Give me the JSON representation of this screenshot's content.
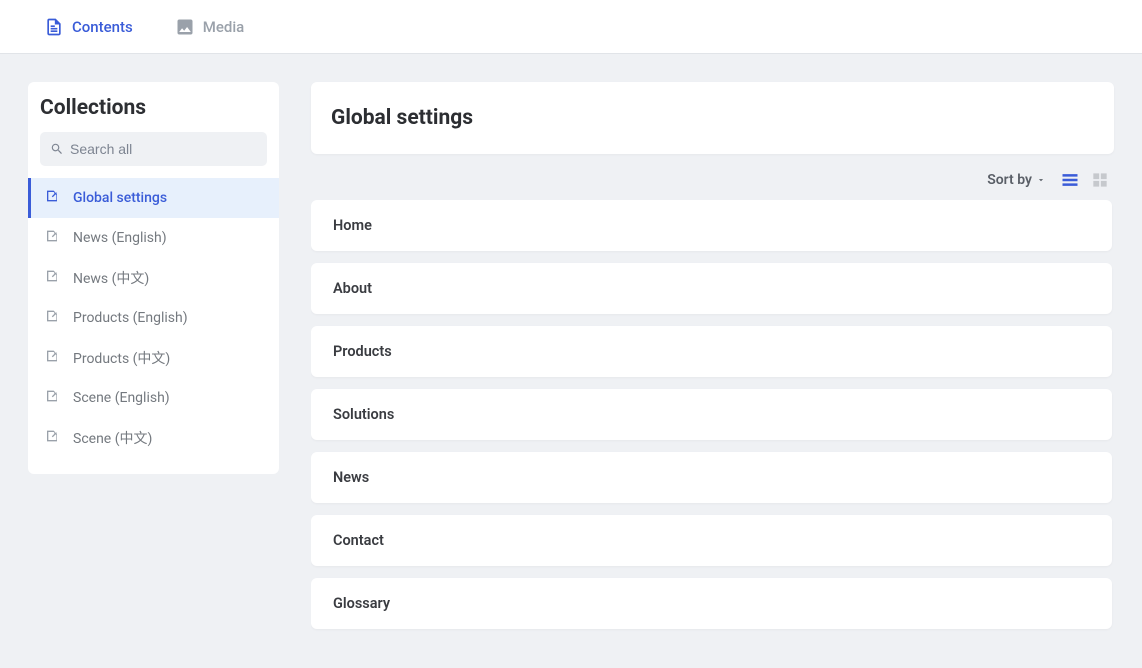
{
  "tabs": {
    "contents": {
      "label": "Contents",
      "active": true
    },
    "media": {
      "label": "Media",
      "active": false
    }
  },
  "sidebar": {
    "title": "Collections",
    "search_placeholder": "Search all",
    "items": [
      {
        "label": "Global settings",
        "active": true
      },
      {
        "label": "News (English)",
        "active": false
      },
      {
        "label": "News (中文)",
        "active": false
      },
      {
        "label": "Products (English)",
        "active": false
      },
      {
        "label": "Products (中文)",
        "active": false
      },
      {
        "label": "Scene (English)",
        "active": false
      },
      {
        "label": "Scene (中文)",
        "active": false
      }
    ]
  },
  "main": {
    "page_title": "Global settings",
    "sort_label": "Sort by",
    "entries": [
      {
        "title": "Home"
      },
      {
        "title": "About"
      },
      {
        "title": "Products"
      },
      {
        "title": "Solutions"
      },
      {
        "title": "News"
      },
      {
        "title": "Contact"
      },
      {
        "title": "Glossary"
      }
    ]
  }
}
